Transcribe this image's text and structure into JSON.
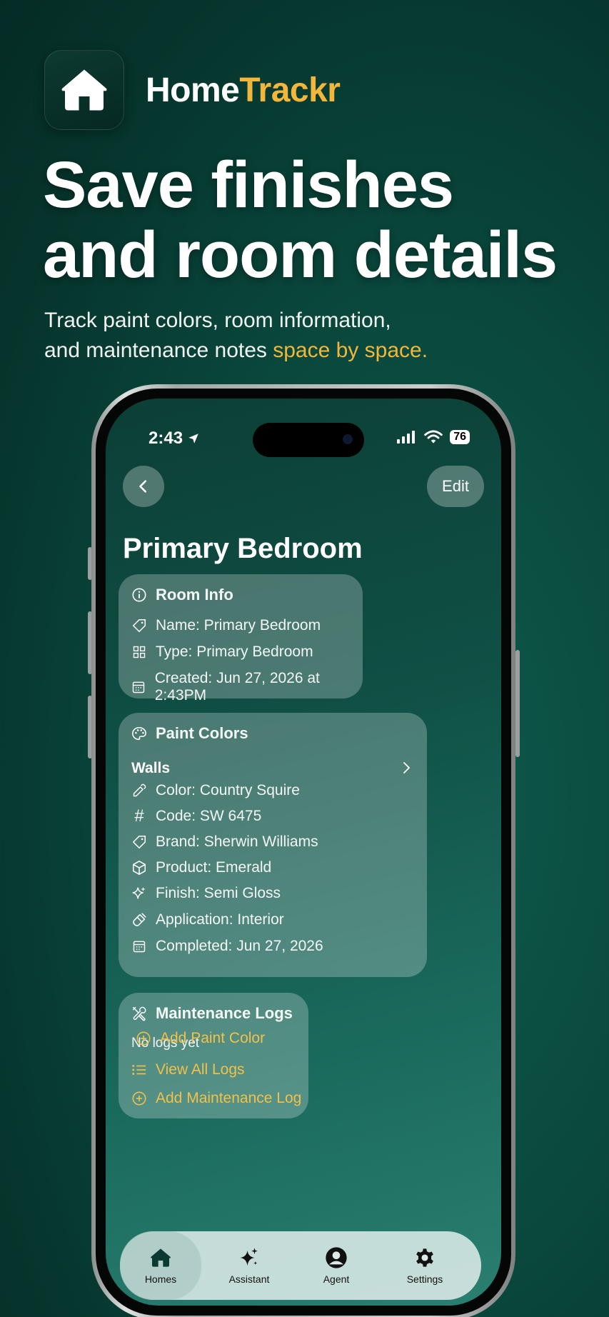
{
  "brand": {
    "name_part1": "Home",
    "name_part2": "Trackr"
  },
  "headline": {
    "line1": "Save finishes",
    "line2": "and room details"
  },
  "subline": {
    "line1": "Track paint colors, room information,",
    "line2_plain": "and maintenance notes ",
    "line2_accent": "space by space."
  },
  "status_bar": {
    "time": "2:43",
    "battery": "76"
  },
  "nav": {
    "edit_label": "Edit"
  },
  "room": {
    "title": "Primary Bedroom"
  },
  "room_info": {
    "heading": "Room Info",
    "name": "Name: Primary Bedroom",
    "type": "Type: Primary Bedroom",
    "created": "Created: Jun 27, 2026 at 2:43PM"
  },
  "paint_colors": {
    "heading": "Paint Colors",
    "group": "Walls",
    "color": "Color: Country Squire",
    "code": "Code: SW 6475",
    "brand": "Brand: Sherwin Williams",
    "product": "Product: Emerald",
    "finish": "Finish: Semi Gloss",
    "application": "Application: Interior",
    "completed": "Completed: Jun 27, 2026",
    "add_label": "Add Paint Color"
  },
  "maintenance": {
    "heading": "Maintenance Logs",
    "empty": "No logs yet",
    "view_all": "View All Logs",
    "add_label": "Add Maintenance Log"
  },
  "tabs": [
    {
      "label": "Homes"
    },
    {
      "label": "Assistant"
    },
    {
      "label": "Agent"
    },
    {
      "label": "Settings"
    }
  ],
  "colors": {
    "accent": "#f2b73a",
    "background": "#0a4a3e"
  }
}
